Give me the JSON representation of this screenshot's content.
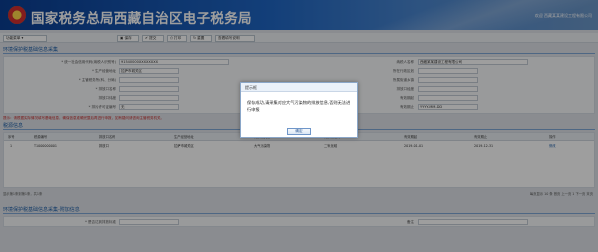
{
  "header": {
    "title": "国家税务总局西藏自治区电子税务局",
    "user": "欢迎 西藏某某建设工程有限公司"
  },
  "toolbar": {
    "select_value": "功能菜单",
    "buttons": [
      "保存",
      "提交",
      "打印",
      "重置",
      "查看填写说明"
    ]
  },
  "section1": {
    "title": "环境保护税基础信息采集"
  },
  "form": {
    "rows": [
      {
        "l1": "* 统一社会信用代码(纳税人识别号)",
        "v1": "91540000XXXXXXXX",
        "l2": "纳税人名称",
        "v2": "西藏某某建设工程有限公司"
      },
      {
        "l1": "* 生产经营地址",
        "v1": "拉萨市城关区",
        "l2": "所在行政区划",
        "v2": ""
      },
      {
        "l1": "* 主管税务所(科、分局)",
        "v1": "",
        "l2": "所属街道乡镇",
        "v2": ""
      },
      {
        "l1": "* 排放口名称",
        "v1": "",
        "l2": "排放口经度",
        "v2": ""
      },
      {
        "l1": "排放口纬度",
        "v1": "",
        "l2": "有效期起",
        "v2": ""
      },
      {
        "l1": "* 排污许可证编号",
        "v1": "无",
        "l2": "有效期止",
        "v2": "YYYY-MM-DD"
      }
    ]
  },
  "notice": "提示：请根据实际情况填写基础信息，确保信息准确完整后再进行申报，如有疑问请咨询主管税务机关。",
  "section2": {
    "title": "税源信息"
  },
  "table": {
    "headers": [
      "序号",
      "税源编号",
      "排放口名称",
      "生产经营地址",
      "污染物类别",
      "污染物名称",
      "有效期起",
      "有效期止",
      "操作"
    ],
    "rows": [
      [
        "1",
        "T1000000001",
        "排放口",
        "拉萨市城关区",
        "大气污染物",
        "二氧化硫",
        "2019-01-01",
        "2019-12-31",
        "修改"
      ]
    ]
  },
  "pager": {
    "left": "显示第1条到第1条，共1条",
    "right": "每页显示 10 条  首页 上一页 1 下一页 末页"
  },
  "section3": {
    "title": "环境保护税基础信息采集-附加信息"
  },
  "extra_row": {
    "l1": "* 是否达到排放标准",
    "v1": "",
    "l2": "备注",
    "v2": ""
  },
  "dialog": {
    "title": "提示框",
    "message": "保存成功,请采集对应大气污染物的排放信息,否则无法进行申报",
    "ok_label": "确定"
  },
  "colors": {
    "header_start": "#0a3e93",
    "header_end": "#6c97c8",
    "section_text": "#1f5fa8",
    "notice_red": "#c62828"
  },
  "icons": [
    "emblem-logo",
    "save-icon",
    "submit-icon",
    "print-icon",
    "reset-icon"
  ]
}
